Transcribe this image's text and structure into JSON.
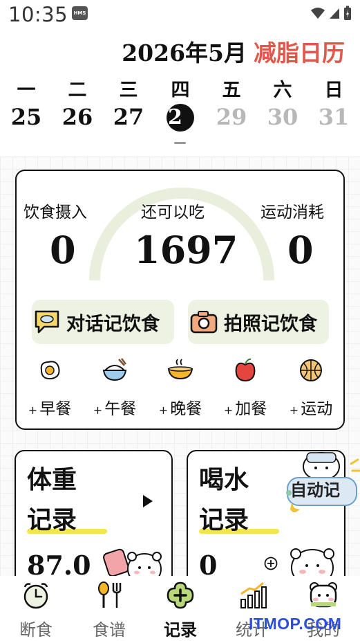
{
  "status_bar": {
    "time": "10:35",
    "badge": "HMS"
  },
  "header": {
    "year_month": "2026年5月",
    "brand": "减脂日历",
    "brand_color": "#e0584a"
  },
  "calendar": {
    "weekdays": [
      "一",
      "二",
      "三",
      "四",
      "五",
      "六",
      "日"
    ],
    "dates": [
      "25",
      "26",
      "27",
      "2",
      "29",
      "30",
      "31"
    ],
    "today_index": 3
  },
  "summary": {
    "intake_label": "饮食摄入",
    "intake_value": "0",
    "remaining_label": "还可以吃",
    "remaining_value": "1697",
    "burn_label": "运动消耗",
    "burn_value": "0",
    "chat_log_label": "对话记饮食",
    "photo_log_label": "拍照记饮食",
    "meals": [
      {
        "label": "早餐",
        "icon": "fried-egg-icon"
      },
      {
        "label": "午餐",
        "icon": "rice-bowl-icon"
      },
      {
        "label": "晚餐",
        "icon": "noodle-bowl-icon"
      },
      {
        "label": "加餐",
        "icon": "apple-icon"
      },
      {
        "label": "运动",
        "icon": "basketball-icon"
      }
    ],
    "meal_plus": "+"
  },
  "weight_card": {
    "line1": "体重",
    "line2": "记录",
    "value": "87.0"
  },
  "water_card": {
    "line1": "喝水",
    "line2": "记录",
    "value": "0"
  },
  "auto_record_bubble": "自动记",
  "tabs": [
    {
      "label": "断食",
      "icon": "alarm-clock-icon",
      "active": false
    },
    {
      "label": "食谱",
      "icon": "spoon-fork-icon",
      "active": false
    },
    {
      "label": "记录",
      "icon": "plus-clover-icon",
      "active": true
    },
    {
      "label": "统计",
      "icon": "bar-chart-icon",
      "active": false
    },
    {
      "label": "我的",
      "icon": "bear-face-icon",
      "active": false
    }
  ],
  "watermark": "ITMOP.COM",
  "colors": {
    "gauge_track": "#e9efdc",
    "action_bg": "#eef2e3",
    "highlight": "#f3e64a"
  }
}
